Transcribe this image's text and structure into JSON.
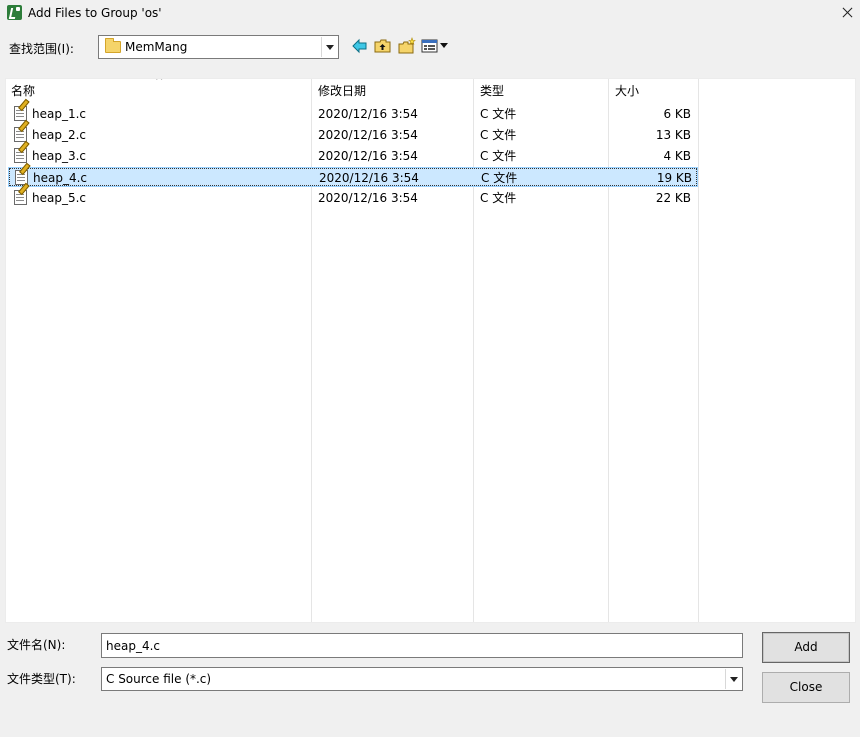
{
  "window": {
    "title": "Add Files to Group 'os'"
  },
  "look_in": {
    "label": "查找范围(I):",
    "value": "MemMang"
  },
  "toolbar": {
    "icons": [
      "back-arrow-icon",
      "up-folder-icon",
      "new-folder-icon",
      "view-menu-icon"
    ]
  },
  "columns": {
    "name": "名称",
    "date": "修改日期",
    "type": "类型",
    "size": "大小",
    "sort_indicator": "^"
  },
  "files": [
    {
      "name": "heap_1.c",
      "date": "2020/12/16 3:54",
      "type": "C 文件",
      "size": "6 KB"
    },
    {
      "name": "heap_2.c",
      "date": "2020/12/16 3:54",
      "type": "C 文件",
      "size": "13 KB"
    },
    {
      "name": "heap_3.c",
      "date": "2020/12/16 3:54",
      "type": "C 文件",
      "size": "4 KB"
    },
    {
      "name": "heap_4.c",
      "date": "2020/12/16 3:54",
      "type": "C 文件",
      "size": "19 KB"
    },
    {
      "name": "heap_5.c",
      "date": "2020/12/16 3:54",
      "type": "C 文件",
      "size": "22 KB"
    }
  ],
  "selected_file_index": 3,
  "file_name": {
    "label": "文件名(N):",
    "value": "heap_4.c"
  },
  "file_type": {
    "label": "文件类型(T):",
    "value": "C Source file (*.c)"
  },
  "buttons": {
    "add": "Add",
    "close": "Close"
  },
  "colors": {
    "selection_bg": "#cce8ff",
    "selection_border": "#99d1ff",
    "dialog_bg": "#f0f0f0"
  }
}
